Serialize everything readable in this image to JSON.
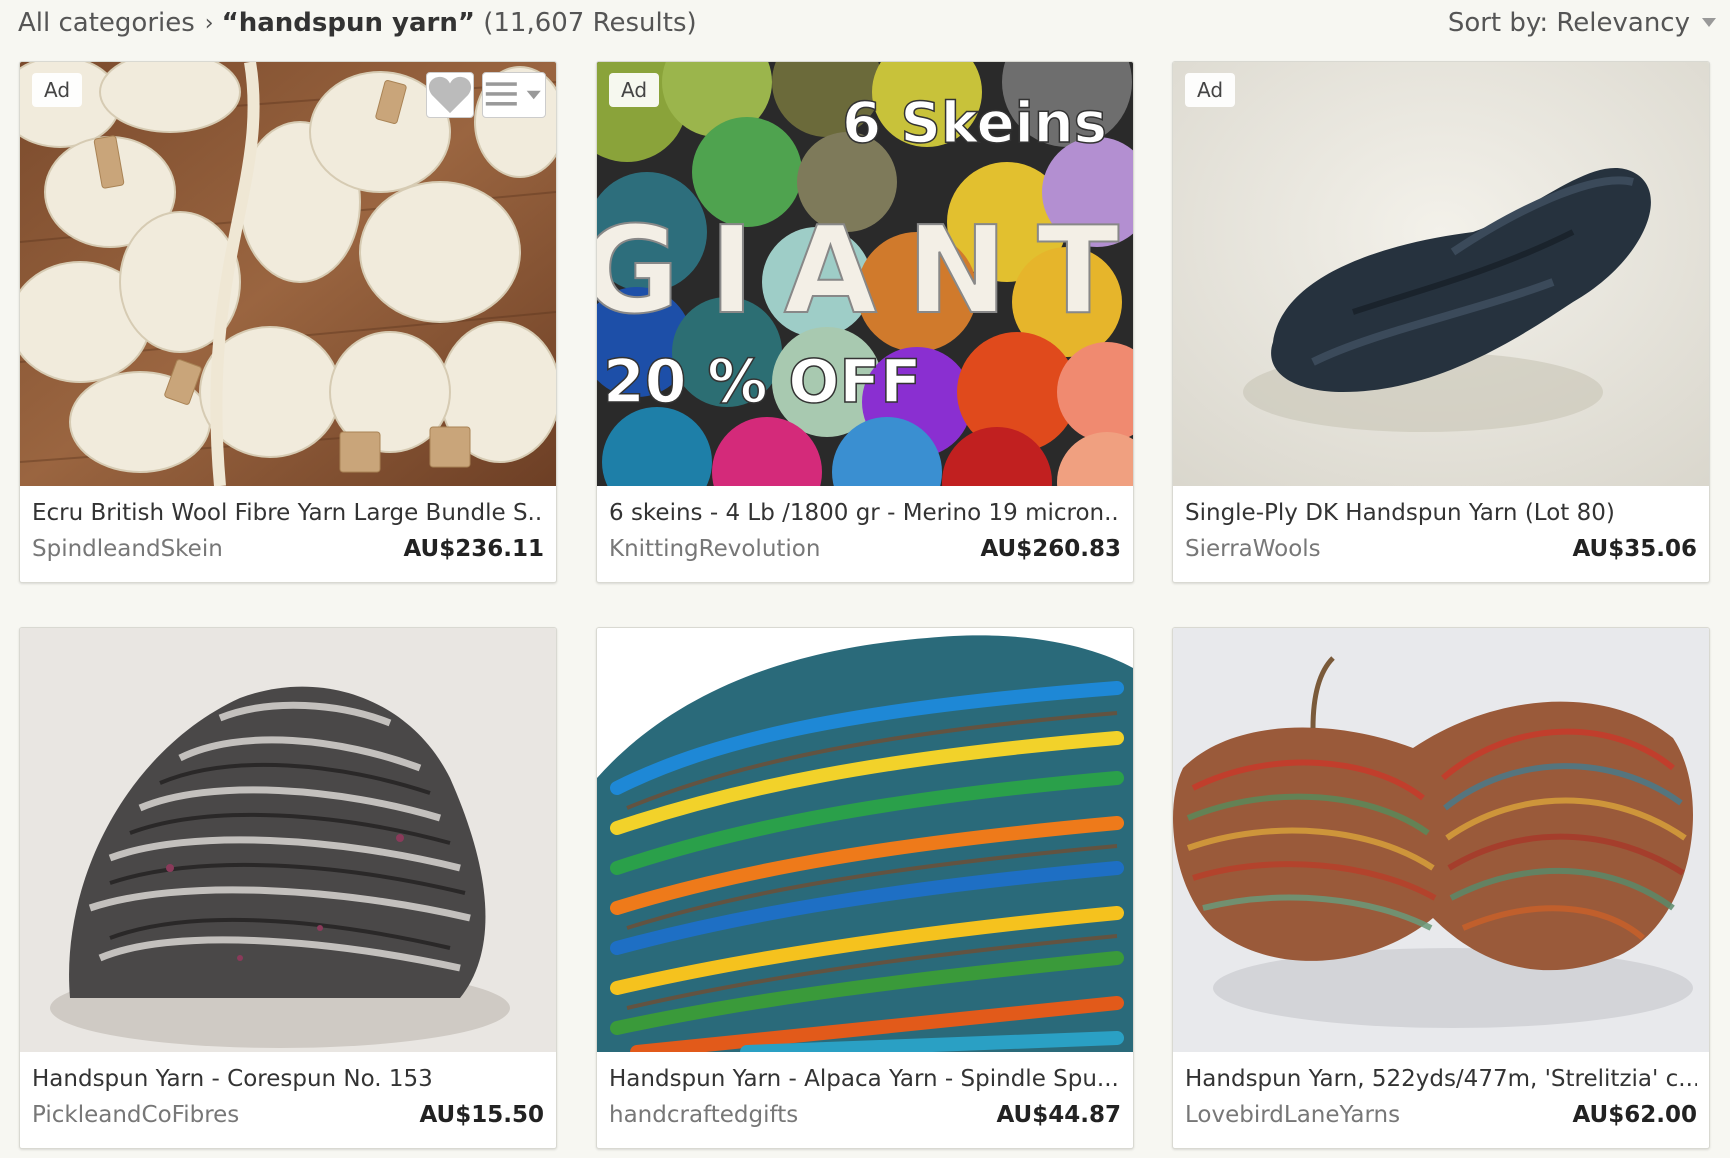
{
  "breadcrumb": {
    "root": "All categories",
    "separator": "›",
    "query": "“handspun yarn”",
    "count": "(11,607 Results)"
  },
  "sort": {
    "label": "Sort by: Relevancy",
    "icon": "caret-down-icon"
  },
  "listings": [
    {
      "ad": "Ad",
      "title": "Ecru British Wool Fibre Yarn Large Bundle S...",
      "shop": "SpindleandSkein",
      "price": "AU$236.11",
      "actions": true
    },
    {
      "ad": "Ad",
      "title": "6 skeins - 4 Lb /1800 gr - Merino 19 micron...",
      "shop": "KnittingRevolution",
      "price": "AU$260.83",
      "image_text": {
        "top": "6 Skeins",
        "middle": "GIANT",
        "bottom": "20 % OFF"
      }
    },
    {
      "ad": "Ad",
      "title": "Single-Ply DK Handspun Yarn (Lot 80)",
      "shop": "SierraWools",
      "price": "AU$35.06"
    },
    {
      "title": "Handspun Yarn - Corespun No. 153",
      "shop": "PickleandCoFibres",
      "price": "AU$15.50"
    },
    {
      "title": "Handspun Yarn - Alpaca Yarn - Spindle Spu...",
      "shop": "handcraftedgifts",
      "price": "AU$44.87"
    },
    {
      "title": "Handspun Yarn, 522yds/477m, 'Strelitzia' c...",
      "shop": "LovebirdLaneYarns",
      "price": "AU$62.00"
    }
  ],
  "icons": {
    "favorite": "heart-icon",
    "add_to_list": "list-menu-icon"
  },
  "colors": {
    "background": "#f7f7f2",
    "card": "#ffffff",
    "text_primary": "#333333",
    "text_secondary": "#777777"
  }
}
